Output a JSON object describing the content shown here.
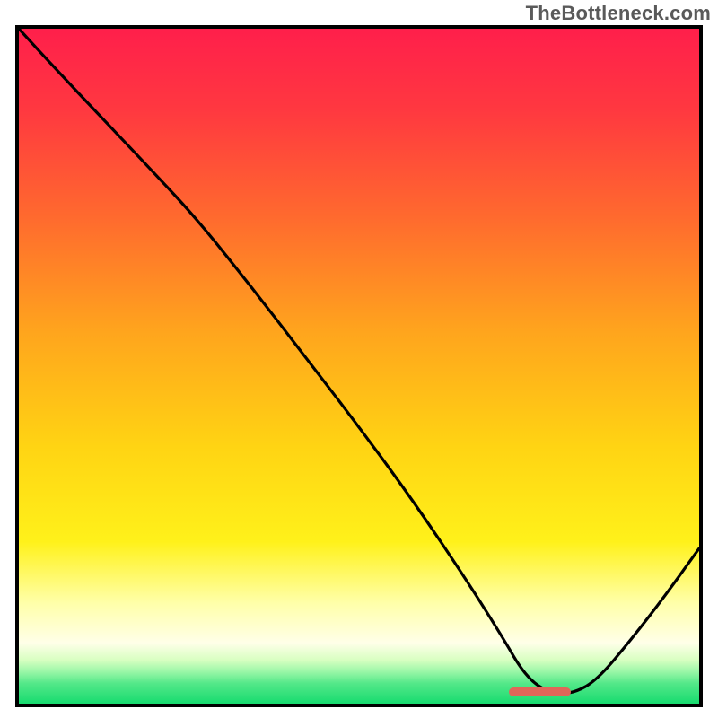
{
  "watermark": "TheBottleneck.com",
  "plot": {
    "width_inner": 758,
    "height_inner": 752
  },
  "colors": {
    "border": "#000000",
    "curve": "#000000",
    "marker": "#e06659",
    "gradient_stops": [
      {
        "pct": 0,
        "color": "#ff1f4b"
      },
      {
        "pct": 12,
        "color": "#ff3840"
      },
      {
        "pct": 28,
        "color": "#ff6a2e"
      },
      {
        "pct": 45,
        "color": "#ffa51d"
      },
      {
        "pct": 62,
        "color": "#ffd413"
      },
      {
        "pct": 76,
        "color": "#fff11a"
      },
      {
        "pct": 85,
        "color": "#ffffa8"
      },
      {
        "pct": 91,
        "color": "#ffffe8"
      },
      {
        "pct": 93.5,
        "color": "#d9ffc2"
      },
      {
        "pct": 95.2,
        "color": "#9cf7a8"
      },
      {
        "pct": 97,
        "color": "#54e889"
      },
      {
        "pct": 100,
        "color": "#17db6f"
      }
    ]
  },
  "valley_marker": {
    "x_start_frac": 0.72,
    "x_end_frac": 0.812,
    "y_frac": 0.982
  },
  "chart_data": {
    "type": "line",
    "title": "",
    "xlabel": "",
    "ylabel": "",
    "xlim": [
      0,
      100
    ],
    "ylim": [
      0,
      100
    ],
    "axes_hidden": true,
    "background": "red-yellow-green vertical gradient (bottleneck heatmap)",
    "series": [
      {
        "name": "bottleneck-curve",
        "x": [
          0.0,
          5.0,
          12.0,
          20.0,
          26.0,
          34.0,
          42.0,
          50.0,
          58.0,
          66.0,
          71.0,
          74.5,
          78.0,
          81.5,
          85.0,
          90.0,
          95.0,
          100.0
        ],
        "y": [
          100.0,
          94.5,
          87.0,
          78.5,
          72.0,
          62.0,
          51.5,
          41.0,
          30.0,
          18.0,
          10.0,
          4.0,
          1.5,
          1.5,
          3.5,
          9.5,
          16.0,
          23.0
        ]
      }
    ],
    "annotations": [
      {
        "type": "segment-marker",
        "name": "optimal-range",
        "x_start": 72.0,
        "x_end": 81.2,
        "y": 1.8,
        "color": "#e06659"
      }
    ],
    "watermark_text": "TheBottleneck.com"
  }
}
